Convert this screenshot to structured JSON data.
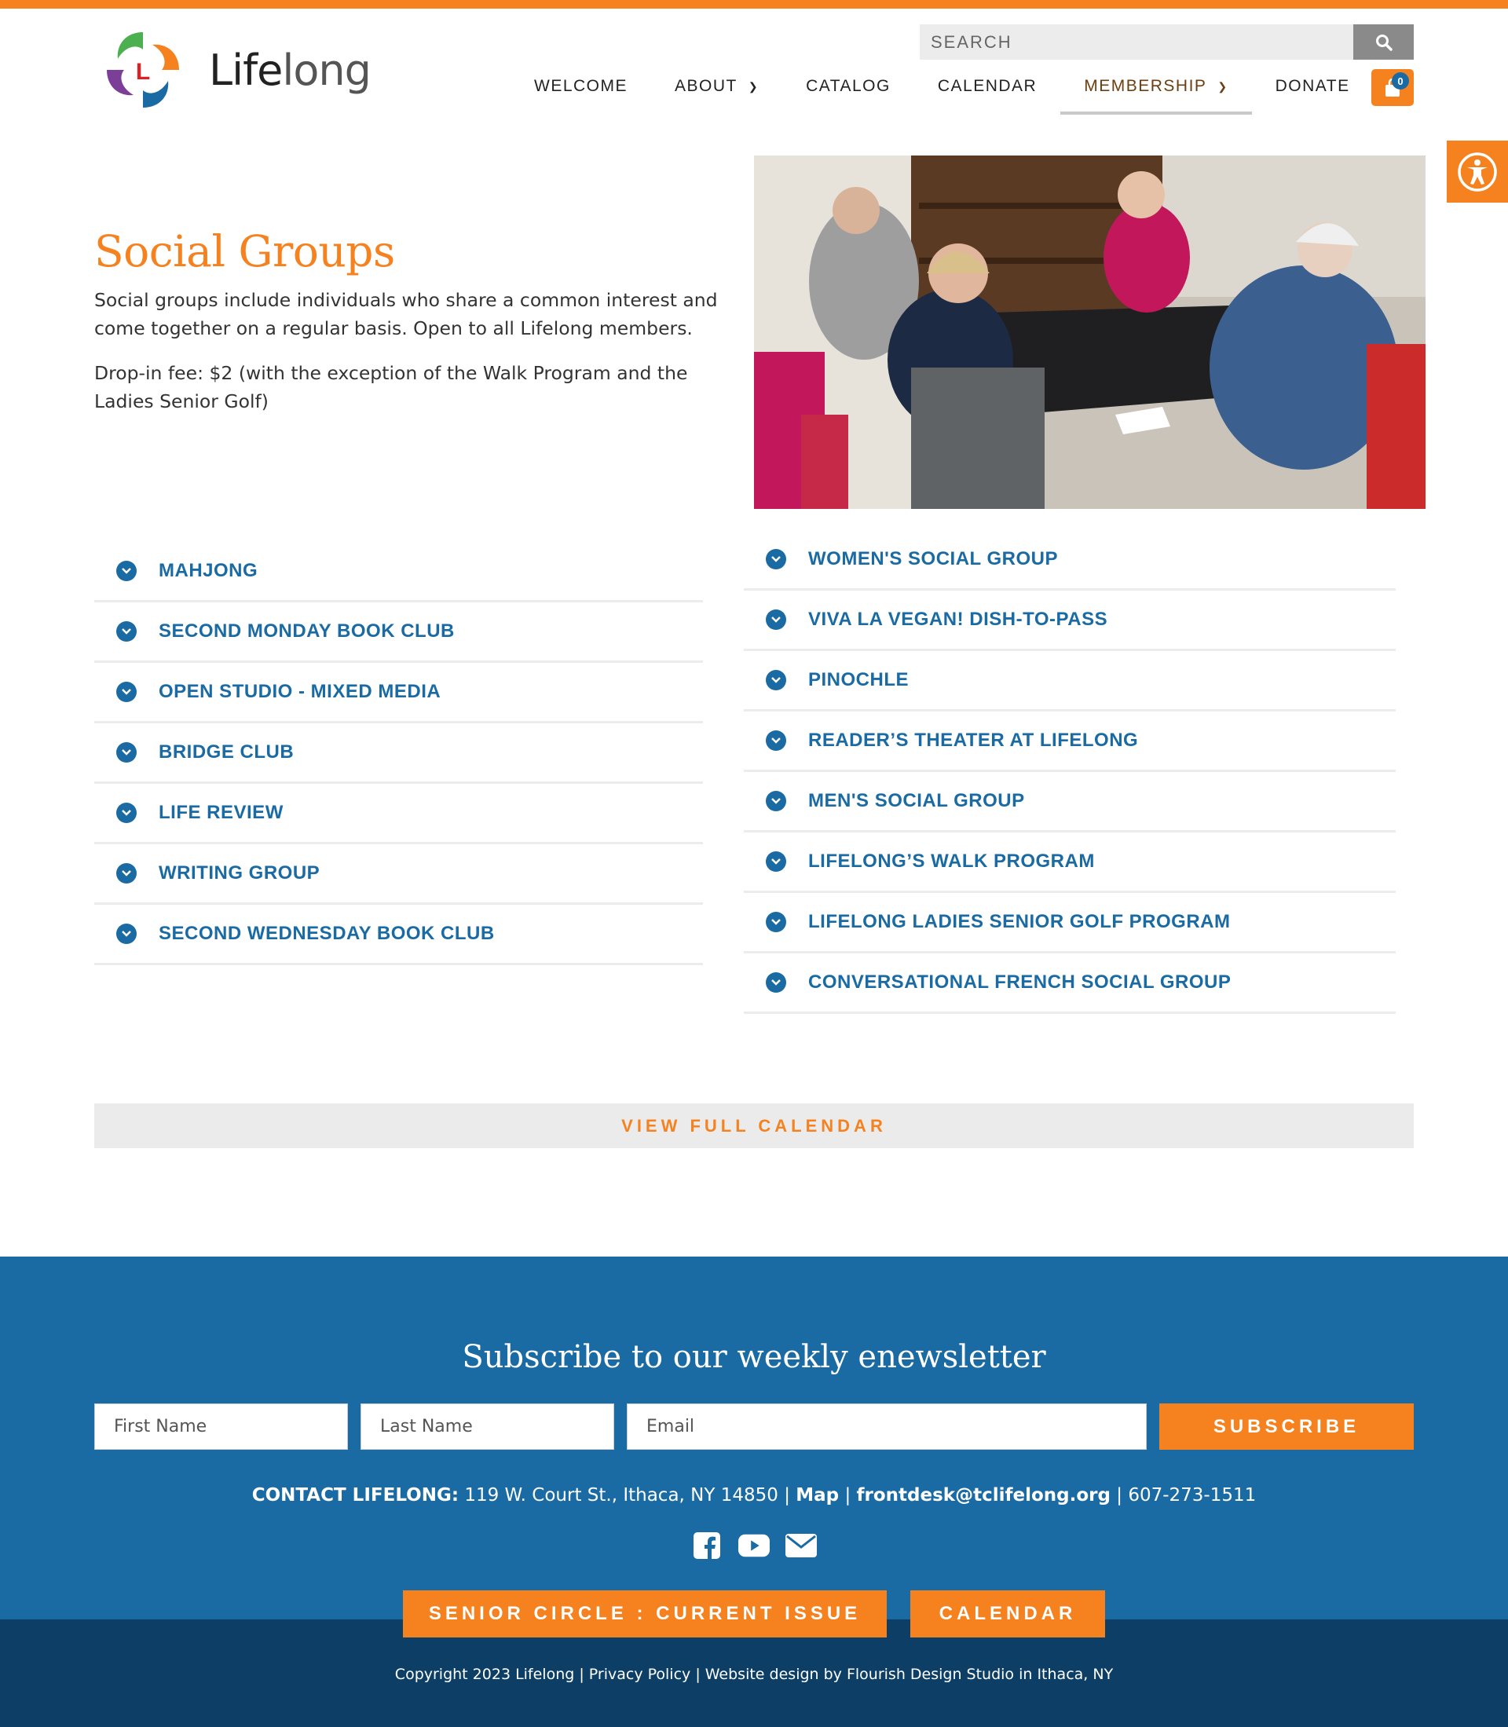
{
  "header": {
    "logo_text_a": "Life",
    "logo_text_b": "long",
    "search_placeholder": "SEARCH",
    "nav": [
      {
        "label": "WELCOME",
        "dropdown": false
      },
      {
        "label": "ABOUT",
        "dropdown": true
      },
      {
        "label": "CATALOG",
        "dropdown": false
      },
      {
        "label": "CALENDAR",
        "dropdown": false
      },
      {
        "label": "MEMBERSHIP",
        "dropdown": true,
        "active": true
      },
      {
        "label": "DONATE",
        "dropdown": false
      }
    ],
    "cart_count": "0"
  },
  "intro": {
    "title": "Social Groups",
    "paragraph1": "Social groups include individuals who share a common interest and come together on a regular basis. Open to all Lifelong members.",
    "paragraph2": "Drop-in fee: $2 (with the exception of the Walk Program and the Ladies Senior Golf)"
  },
  "groups_left": [
    "MAHJONG",
    "SECOND MONDAY BOOK CLUB",
    "OPEN STUDIO - MIXED MEDIA",
    "BRIDGE CLUB",
    "LIFE REVIEW",
    "WRITING GROUP",
    "SECOND WEDNESDAY BOOK CLUB"
  ],
  "groups_right": [
    "WOMEN'S SOCIAL GROUP",
    "VIVA LA VEGAN! DISH-TO-PASS",
    "PINOCHLE",
    "READER’S THEATER AT LIFELONG",
    "MEN'S SOCIAL GROUP",
    "LIFELONG’S WALK PROGRAM",
    "LIFELONG LADIES SENIOR GOLF PROGRAM",
    "CONVERSATIONAL FRENCH SOCIAL GROUP"
  ],
  "view_calendar_label": "VIEW FULL CALENDAR",
  "footer": {
    "subscribe_title": "Subscribe to our weekly enewsletter",
    "first_name_placeholder": "First Name",
    "last_name_placeholder": "Last Name",
    "email_placeholder": "Email",
    "subscribe_label": "SUBSCRIBE",
    "contact_label": "CONTACT LIFELONG:",
    "address": "119 W. Court St., Ithaca, NY 14850",
    "map_link": "Map",
    "email_link": "frontdesk@tclifelong.org",
    "phone": "607-273-1511",
    "social_icons": [
      "facebook-icon",
      "youtube-icon",
      "email-icon"
    ],
    "senior_circle_label": "SENIOR CIRCLE : CURRENT ISSUE",
    "calendar_label": "CALENDAR",
    "copyright": "Copyright 2023 Lifelong | Privacy Policy | Website design by Flourish Design Studio in Ithaca, NY"
  },
  "colors": {
    "accent_orange": "#f5821f",
    "brand_blue": "#1a6aa4",
    "footer_dark": "#0d3f66"
  }
}
